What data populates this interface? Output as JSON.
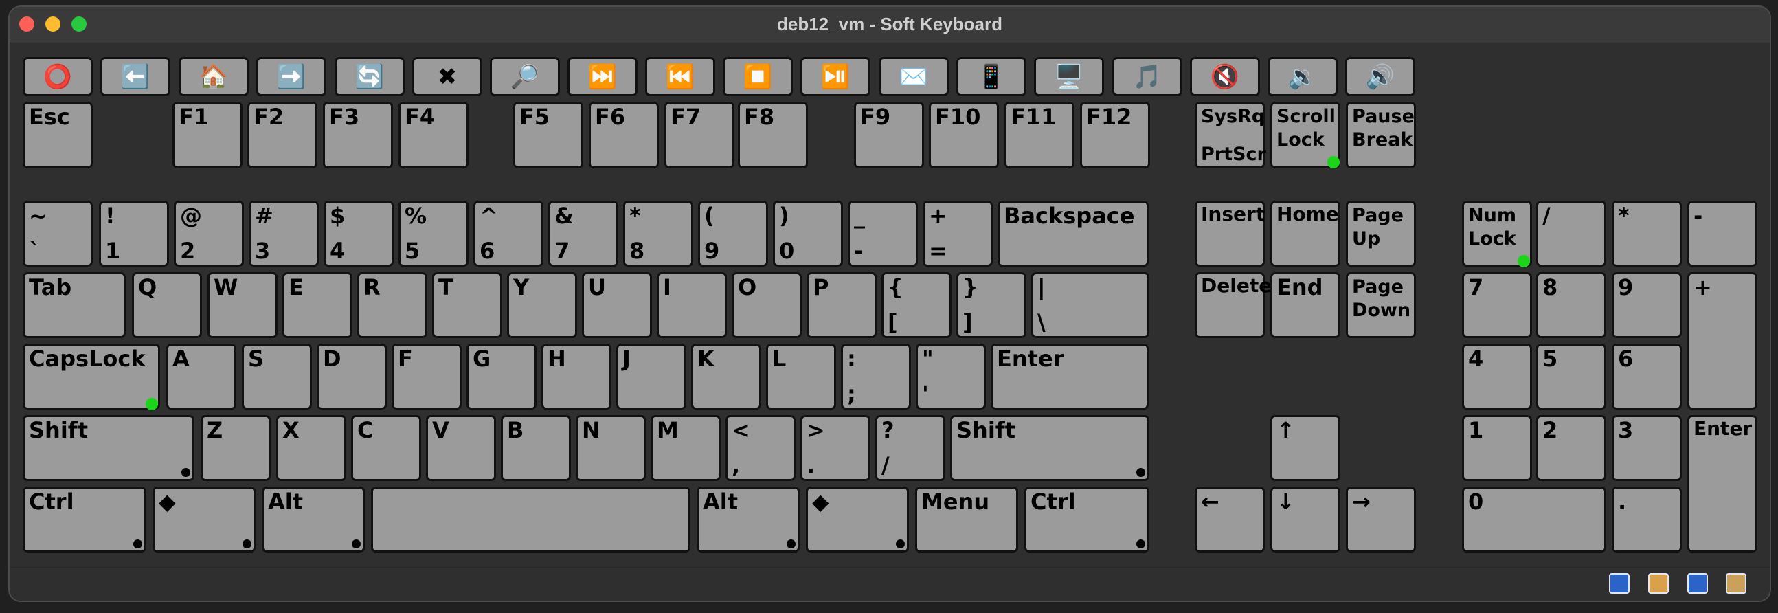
{
  "window": {
    "title": "deb12_vm - Soft Keyboard"
  },
  "media_keys": [
    {
      "icon": "power-icon",
      "glyph": "⭕"
    },
    {
      "icon": "back-arrow-icon",
      "glyph": "⬅️"
    },
    {
      "icon": "home-icon",
      "glyph": "🏠"
    },
    {
      "icon": "forward-arrow-icon",
      "glyph": "➡️"
    },
    {
      "icon": "refresh-icon",
      "glyph": "🔄"
    },
    {
      "icon": "stop-x-icon",
      "glyph": "✖"
    },
    {
      "icon": "search-icon",
      "glyph": "🔎"
    },
    {
      "icon": "next-track-icon",
      "glyph": "⏭️"
    },
    {
      "icon": "previous-track-icon",
      "glyph": "⏮️"
    },
    {
      "icon": "stop-icon",
      "glyph": "⏹️"
    },
    {
      "icon": "play-pause-icon",
      "glyph": "⏯️"
    },
    {
      "icon": "mail-icon",
      "glyph": "✉️"
    },
    {
      "icon": "phone-icon",
      "glyph": "📱"
    },
    {
      "icon": "computer-icon",
      "glyph": "🖥️"
    },
    {
      "icon": "music-icon",
      "glyph": "🎵"
    },
    {
      "icon": "mute-icon",
      "glyph": "🔇"
    },
    {
      "icon": "volume-down-icon",
      "glyph": "🔉"
    },
    {
      "icon": "volume-up-icon",
      "glyph": "🔊"
    }
  ],
  "keys": {
    "esc": "Esc",
    "f1": "F1",
    "f2": "F2",
    "f3": "F3",
    "f4": "F4",
    "f5": "F5",
    "f6": "F6",
    "f7": "F7",
    "f8": "F8",
    "f9": "F9",
    "f10": "F10",
    "f11": "F11",
    "f12": "F12",
    "sysrq": "SysRq",
    "prtscr": "PrtScr",
    "scroll": "Scroll\nLock",
    "pause": "Pause\nBreak",
    "tilde": "~",
    "backtick": "`",
    "excl": "!",
    "n1": "1",
    "at": "@",
    "n2": "2",
    "hash": "#",
    "n3": "3",
    "dollar": "$",
    "n4": "4",
    "pct": "%",
    "n5": "5",
    "caret": "^",
    "n6": "6",
    "amp": "&",
    "n7": "7",
    "star": "*",
    "n8": "8",
    "lparen": "(",
    "n9": "9",
    "rparen": ")",
    "n0": "0",
    "under": "_",
    "minus": "-",
    "plus": "+",
    "equal": "=",
    "backspace": "Backspace",
    "insert": "Insert",
    "home": "Home",
    "pgup": "Page\nUp",
    "numlock": "Num\nLock",
    "np_slash": "/",
    "np_star": "*",
    "np_minus": "-",
    "tab": "Tab",
    "q": "Q",
    "w": "W",
    "e": "E",
    "r": "R",
    "t": "T",
    "y": "Y",
    "u": "U",
    "i": "I",
    "o": "O",
    "p": "P",
    "lbrace": "{",
    "lbracket": "[",
    "rbrace": "}",
    "rbracket": "]",
    "pipe": "|",
    "backslash": "\\",
    "delete": "Delete",
    "end": "End",
    "pgdn": "Page\nDown",
    "np7": "7",
    "np8": "8",
    "np9": "9",
    "np_plus": "+",
    "caps": "CapsLock",
    "a": "A",
    "s": "S",
    "d": "D",
    "f": "F",
    "g": "G",
    "h": "H",
    "j": "J",
    "k": "K",
    "l": "L",
    "colon": ":",
    "semicolon": ";",
    "quote": "\"",
    "apos": "'",
    "enter": "Enter",
    "np4": "4",
    "np5": "5",
    "np6": "6",
    "lshift": "Shift",
    "z": "Z",
    "x": "X",
    "c": "C",
    "v": "V",
    "b": "B",
    "n": "N",
    "m": "M",
    "lt": "<",
    "comma": ",",
    "gt": ">",
    "period": ".",
    "question": "?",
    "slash": "/",
    "rshift": "Shift",
    "up": "↑",
    "np1": "1",
    "np2": "2",
    "np3": "3",
    "np_enter": "Enter",
    "lctrl": "Ctrl",
    "lwin": "◆",
    "lalt": "Alt",
    "space": "",
    "ralt": "Alt",
    "rwin": "◆",
    "menu": "Menu",
    "rctrl": "Ctrl",
    "left": "←",
    "down": "↓",
    "right": "→",
    "np0": "0",
    "np_dot": "."
  },
  "status_icons": [
    "keyboard-layout-icon",
    "settings-gear-icon",
    "language-icon",
    "window-icon"
  ]
}
